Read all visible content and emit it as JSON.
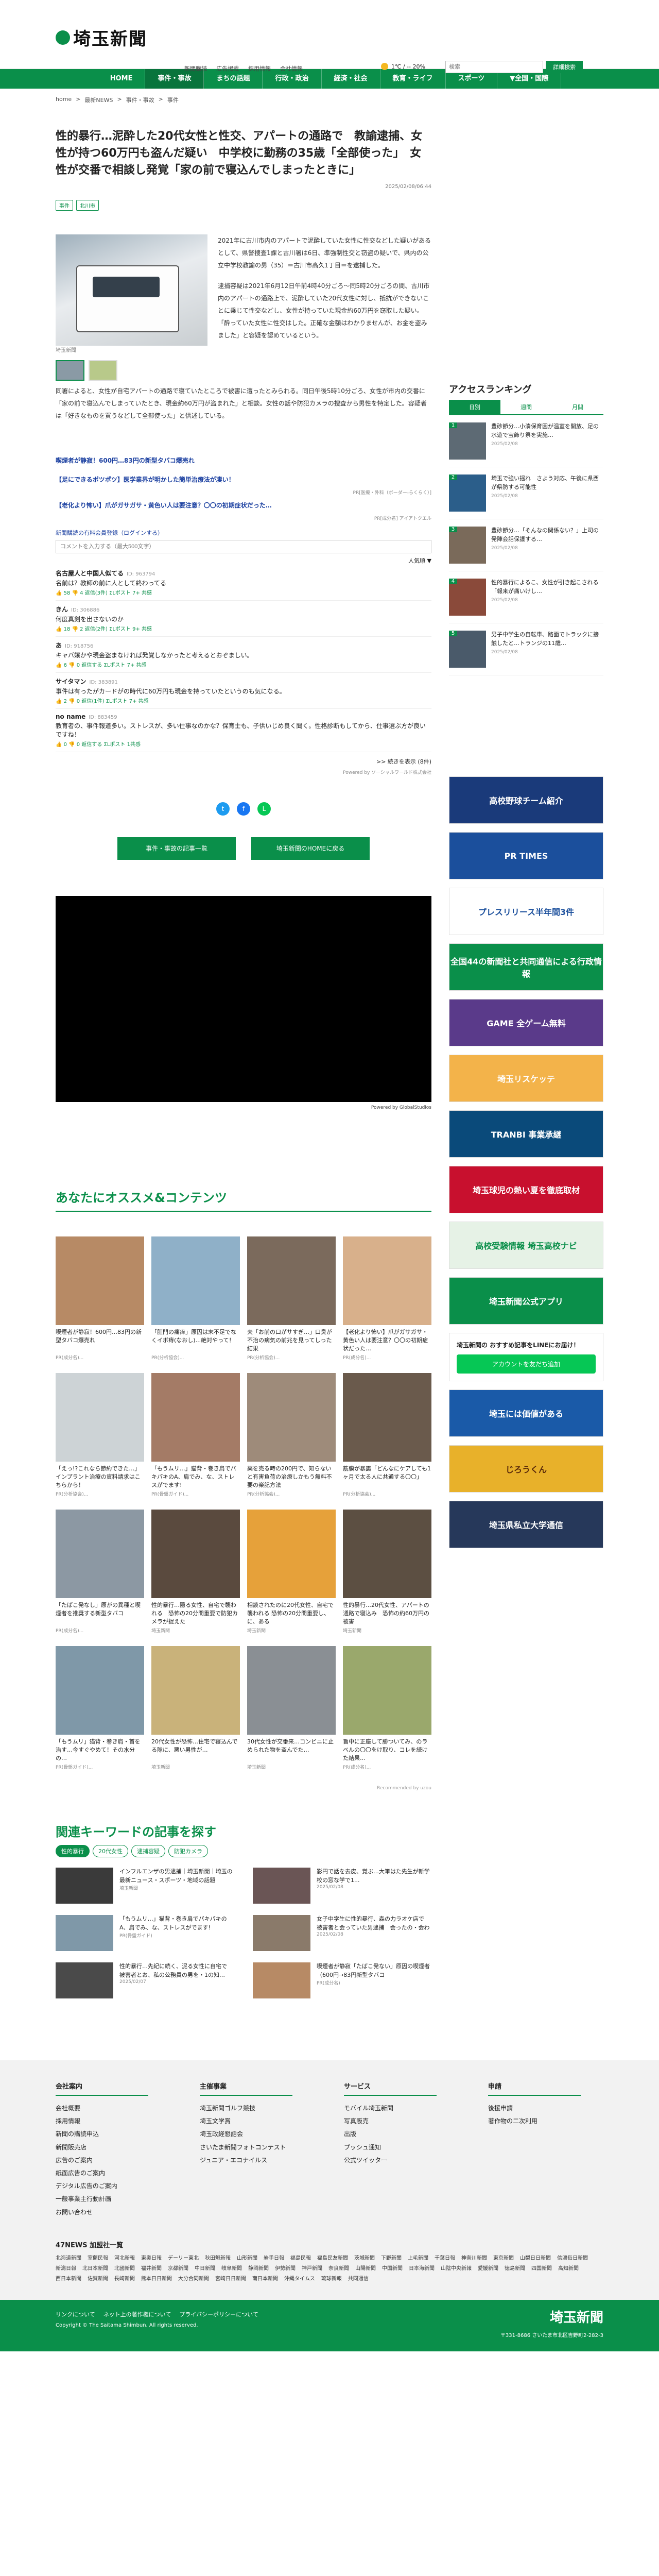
{
  "header": {
    "logo": "埼玉新聞",
    "links": [
      "新聞購読",
      "広告掲載",
      "採用情報",
      "会社情報"
    ],
    "weather": "1℃ / -- 20%",
    "search_placeholder": "検索",
    "search_button": "詳細検索"
  },
  "nav": [
    "HOME",
    "事件・事故",
    "まちの話題",
    "行政・政治",
    "経済・社会",
    "教育・ライフ",
    "スポーツ",
    "▼全国・国際"
  ],
  "breadcrumb": [
    "home",
    ">",
    "最新NEWS",
    ">",
    "事件・事故",
    ">",
    "事件"
  ],
  "article": {
    "headline": "性的暴行…泥酔した20代女性と性交、アパートの通路で　教諭逮捕、女性が持つ60万円も盗んだ疑い　中学校に勤務の35歳「全部使った」　女性が交番で相談し発覚「家の前で寝込んでしまったときに」",
    "date": "2025/02/08/06:44",
    "tags": [
      "事件",
      "北川市"
    ],
    "photo_caption": "埼玉新聞",
    "para1": "2021年に古川市内のアパートで泥酔していた女性に性交などした疑いがあるとして、県警捜査1課と古川署は6日、準強制性交と窃盗の疑いで、県内の公立中学校教諭の男（35）＝古川市高久1丁目＝を逮捕した。",
    "para2": "逮捕容疑は2021年6月12日午前4時40分ごろ～同5時20分ごろの間、古川市内のアパートの通路上で、泥酔していた20代女性に対し、抵抗ができないことに乗じて性交などし、女性が持っていた現金約60万円を窃取した疑い。「酔っていた女性に性交はした。正確な金額はわかりませんが、お金を盗みました」と容疑を認めているという。",
    "para3": "同署によると、女性が自宅アパートの通路で寝ていたところで被害に遭ったとみられる。同日午後5時10分ごろ、女性が市内の交番に「家の前で寝込んでしまっていたとき、現金約60万円が盗まれた」と相談。女性の話や防犯カメラの捜査から男性を特定した。容疑者は「好きなものを買うなどして全部使った」と供述している。"
  },
  "ads": {
    "row1": "喫煙者が静寂！600円…83円の新型タバコ爆売れ",
    "row2a": "【足にできるポツポツ】医学業界が明かした簡単治療法が凄い！",
    "row2a_pr": "PR[医療・外科（ボーダー-らくらく）]",
    "row2b": "【老化より怖い】爪がガサガサ・黄色い人は要注意？〇〇の初期症状だった…",
    "row2b_pr": "PR[成分名] アイアトクエル"
  },
  "comments": {
    "link": "新聞購読の有料会員登録（ログインする）",
    "placeholder": "コメントを入力する（最大500文字）",
    "sort": "人気順 ▼",
    "items": [
      {
        "name": "名古屋人と中国人似てる",
        "id": "ID: 963794",
        "body": "名前は？教師の前に人として終わってる",
        "meta": "👍 58  👎 4  返信(3件)  ΣLポスト  7+ 共感"
      },
      {
        "name": "きん",
        "id": "ID: 306886",
        "body": "何度真剣を出さないのか",
        "meta": "👍 18  👎 2  返信(2件)  ΣLポスト  9+ 共感"
      },
      {
        "name": "あ",
        "id": "ID: 918756",
        "body": "キャバ嬢かや現金盗まなければ発覚しなかったと考えるとおぞましい。",
        "meta": "👍 6  👎 0  返信する  ΣLポスト  7+ 共感"
      },
      {
        "name": "サイタマン",
        "id": "ID: 383891",
        "body": "事件は有ったがカードがの時代に60万円も現金を持っていたというのも気になる。",
        "meta": "👍 2  👎 0  返信(1件)  ΣLポスト  7+ 共感"
      },
      {
        "name": "no name",
        "id": "ID: 883459",
        "body": "教育者の、事件報道多い。ストレスが、多い仕事なのかな？保育士も、子供いじめ良く聞く。性格診断もしてから、仕事選ぶ方が良いですね！",
        "meta": "👍 0  👎 0  返信する  ΣLポスト  1共感"
      }
    ],
    "more": ">> 続きを表示 (8件)",
    "powered": "Powered by ソーシャルワールド株式会社"
  },
  "share_icons": [
    "twitter-icon",
    "facebook-icon",
    "line-icon"
  ],
  "buttons": {
    "list": "事件・事故の記事一覧",
    "home": "埼玉新聞のHOMEに戻る"
  },
  "video_caption": "Powered by GlobalStudios",
  "recommend": {
    "title": "あなたにオススメ&コンテンツ",
    "cards": [
      {
        "t": "喫煙者が静寂！600円…83円の新型タバコ爆売れ",
        "s": "PR(成分名)...",
        "c": "#b78a65"
      },
      {
        "t": "「肛門の痛痒」原因は末不足でなくイボ痔(なおし)...絶対やって！",
        "s": "PR(分析協会)...",
        "c": "#8fb0c8"
      },
      {
        "t": "夫「お前の口がサすぎ…」口臭が不治の病気の前兆を見ってしった結果",
        "s": "PR(分析協会)...",
        "c": "#7b6a5c"
      },
      {
        "t": "【老化より怖い】爪がガサガサ・黄色い人は要注意？〇〇の初期症状だった…",
        "s": "PR(成分名)...",
        "c": "#d8b08b"
      },
      {
        "t": "「えっ!?これなら節約できた…」インプラント治療の資料請求はこちらから！",
        "s": "PR(分析協会)...",
        "c": "#cdd3d6"
      },
      {
        "t": "「もうムリ…」猫背・巻き肩でパキパキのA、肩でみ、な、ストレスがでます!",
        "s": "PR(骨盤ガイド)...",
        "c": "#a47b66"
      },
      {
        "t": "薬を売る時の200円で、知らないと有害負荷の治療しかもう無料不要の楽記方法",
        "s": "PR(分析協会)...",
        "c": "#9e8b7a"
      },
      {
        "t": "筋膜が暴露「どんなにケアしても1ヶ月で太る人に共通する〇〇」",
        "s": "PR(分析協会)...",
        "c": "#6a5a4c"
      },
      {
        "t": "「たぱこ発なし」原がの異種と喫煙者を推奨する新型タバコ",
        "s": "PR(成分名)...",
        "c": "#8c98a3"
      },
      {
        "t": "性的暴行…隠る女性、自宅で襲われる　恐怖の20分間重要で防犯カメラが捉えた",
        "s": "埼玉新聞",
        "c": "#5a4a3e"
      },
      {
        "t": "相談されたのに20代女性、自宅で襲われる 恐怖の20分間重要し、に、ある",
        "s": "埼玉新聞",
        "c": "#e6a13a"
      },
      {
        "t": "性的暴行…20代女性、アパートの通路で寝込み　恐怖の約60万円の被害",
        "s": "埼玉新聞",
        "c": "#5c4f42"
      },
      {
        "t": "「もうムリ」猫背・巻き肩・首を治す…今すぐやめて！その水分の…",
        "s": "PR(骨盤ガイド)...",
        "c": "#7f98a8"
      },
      {
        "t": "20代女性が恐怖…住宅で寝込んでる隙に、悪い男性が…",
        "s": "埼玉新聞",
        "c": "#c9b27a"
      },
      {
        "t": "30代女性が交番来…コンビニに止められた物を盗んでた…",
        "s": "埼玉新聞",
        "c": "#8a8f94"
      },
      {
        "t": "旨中に正座して勝ついてみ、のラベルの〇〇をけ取り、コレを続けた結果…",
        "s": "PR(成分名)...",
        "c": "#9aa86c"
      }
    ],
    "credit": "Recommended by uzou"
  },
  "keywords": {
    "title": "関連キーワードの記事を探す",
    "tabs": [
      "性的暴行",
      "20代女性",
      "逮捕容疑",
      "防犯カメラ"
    ],
    "items": [
      {
        "t": "インフルエンザの男逮捕｜埼玉新聞｜埼玉の最新ニュース・スポーツ・地域の話題",
        "s": "埼玉新聞",
        "c": "#3a3a3a"
      },
      {
        "t": "影円で話を去皮、覚ぶ…大筆はた先生が新学校の窓な学で1...",
        "s": "2025/02/08",
        "c": "#6a5555"
      },
      {
        "t": "「もうムリ…」猫背・巻き肩でパキパキのA、肩でみ、な、ストレスがでます!",
        "s": "PR(骨盤ガイド)",
        "c": "#7f98a8"
      },
      {
        "t": "女子中学生に性的暴行、森の力ラオケ店で　被害者と会っていた男逮捕　会ったの・会わ",
        "s": "2025/02/08",
        "c": "#8a7a6a"
      },
      {
        "t": "性的暴行…先紀に続く、泥る女性に自宅で　被害者とお、私の公務員の男を・1の知…",
        "s": "2025/02/07",
        "c": "#4a4a4a"
      },
      {
        "t": "喫煙者が静寂「たばこ発ない」原因の喫煙者（600円→83円新型タバコ",
        "s": "PR(成分名)",
        "c": "#b78a65"
      }
    ]
  },
  "sidebar": {
    "rank_title": "アクセスランキング",
    "rank_tabs": [
      "日別",
      "週間",
      "月間"
    ],
    "rank_items": [
      {
        "n": "1",
        "t": "豊砂節分…小湊保育園が温室を開放、足の水遊で宝飾り祭を実施…",
        "d": "2025/02/08",
        "c": "#5d6a74"
      },
      {
        "t": "埼玉で強い揺れ　さよう対応、午後に県西が県防する可能性",
        "d": "2025/02/08",
        "c": "#2b5e8a",
        "n": "2"
      },
      {
        "t": "豊砂節分…「そんなの関係ない？」上司の発陣会話保護する…",
        "d": "2025/02/08",
        "c": "#7a6a5a",
        "n": "3"
      },
      {
        "t": "性的暴行によるこ、女性が引き起こされる「報来が痛いけし…",
        "d": "2025/02/08",
        "c": "#8a4a3a",
        "n": "4"
      },
      {
        "t": "男子中学生の自転車、路面でトラックに接触したと…トランジの11歳…",
        "d": "2025/02/08",
        "c": "#4a5a6a",
        "n": "5"
      }
    ],
    "banners": [
      {
        "t": "高校野球チーム紹介",
        "bg": "#1a3a7a",
        "fg": "#fff",
        "h": 92
      },
      {
        "t": "PR TIMES",
        "bg": "#1b4f9c",
        "fg": "#fff",
        "h": 92
      },
      {
        "t": "プレスリリース半年間3件",
        "bg": "#ffffff",
        "fg": "#1b4f9c",
        "h": 92
      },
      {
        "t": "全国44の新聞社と共同通信による行政情報",
        "bg": "#0a8f4a",
        "fg": "#fff",
        "h": 92
      },
      {
        "t": "GAME 全ゲーム無料",
        "bg": "#5a3a8a",
        "fg": "#fff",
        "h": 92
      },
      {
        "t": "埼玉リスケッテ",
        "bg": "#f3b34a",
        "fg": "#fff",
        "h": 92
      },
      {
        "t": "TRANBI 事業承継",
        "bg": "#0a4a7a",
        "fg": "#fff",
        "h": 92
      },
      {
        "t": "埼玉球児の熱い夏を徹底取材",
        "bg": "#c8102e",
        "fg": "#fff",
        "h": 92
      },
      {
        "t": "高校受験情報 埼玉高校ナビ",
        "bg": "#e6f2e6",
        "fg": "#0a8f4a",
        "h": 92
      },
      {
        "t": "埼玉新聞公式アプリ",
        "bg": "#0a8f4a",
        "fg": "#fff",
        "h": 92
      }
    ],
    "line_title": "埼玉新聞の おすすめ記事をLINEにお届け！",
    "line_button": "アカウントを友だち追加",
    "banners2": [
      {
        "t": "埼玉には価値がある",
        "bg": "#1a5aa8",
        "fg": "#fff",
        "h": 92
      },
      {
        "t": "じろうくん",
        "bg": "#e8b12a",
        "fg": "#5a2a0a",
        "h": 92
      },
      {
        "t": "埼玉県私立大学通信",
        "bg": "#26385a",
        "fg": "#fff",
        "h": 92
      }
    ]
  },
  "footer": {
    "cols": [
      {
        "h": "会社案内",
        "l": [
          "会社概要",
          "採用情報",
          "新聞の購読申込",
          "新聞販売店",
          "広告のご案内",
          "紙面広告のご案内",
          "デジタル広告のご案内",
          "一般事業主行動計画",
          "お問い合わせ"
        ]
      },
      {
        "h": "主催事業",
        "l": [
          "埼玉新聞ゴルフ競技",
          "埼玉文学賞",
          "埼玉政経懇話会",
          "さいたま新聞フォトコンテスト",
          "ジュニア・エコナイルス"
        ]
      },
      {
        "h": "サービス",
        "l": [
          "モバイル埼玉新聞",
          "写真販売",
          "出版",
          "プッシュ通知",
          "公式ツイッター"
        ]
      },
      {
        "h": "申請",
        "l": [
          "後援申請",
          "著作物の二次利用"
        ]
      }
    ],
    "news47_title": "47NEWS 加盟社一覧",
    "news47": [
      "北海道新聞",
      "室蘭民報",
      "河北新報",
      "東奥日報",
      "デーリー東北",
      "秋田魁新報",
      "山形新聞",
      "岩手日報",
      "福島民報",
      "福島民友新聞",
      "茨城新聞",
      "下野新聞",
      "上毛新聞",
      "千葉日報",
      "神奈川新聞",
      "東京新聞",
      "山梨日日新聞",
      "信濃毎日新聞",
      "新潟日報",
      "北日本新聞",
      "北國新聞",
      "福井新聞",
      "京都新聞",
      "中日新聞",
      "岐阜新聞",
      "静岡新聞",
      "伊勢新聞",
      "神戸新聞",
      "奈良新聞",
      "山陽新聞",
      "中国新聞",
      "日本海新聞",
      "山陰中央新報",
      "愛媛新聞",
      "徳島新聞",
      "四国新聞",
      "高知新聞",
      "西日本新聞",
      "佐賀新聞",
      "長崎新聞",
      "熊本日日新聞",
      "大分合同新聞",
      "宮崎日日新聞",
      "南日本新聞",
      "沖縄タイムス",
      "琉球新報",
      "共同通信"
    ],
    "bottom_links": [
      "リンクについて",
      "ネット上の著作権について",
      "プライバシーポリシーについて"
    ],
    "copyright": "Copyright © The Saitama Shimbun, All rights reserved.",
    "address": "〒331-8686 さいたま市北区吉野町2-282-3"
  },
  "colors": {
    "accent": "#0a8f4a"
  }
}
